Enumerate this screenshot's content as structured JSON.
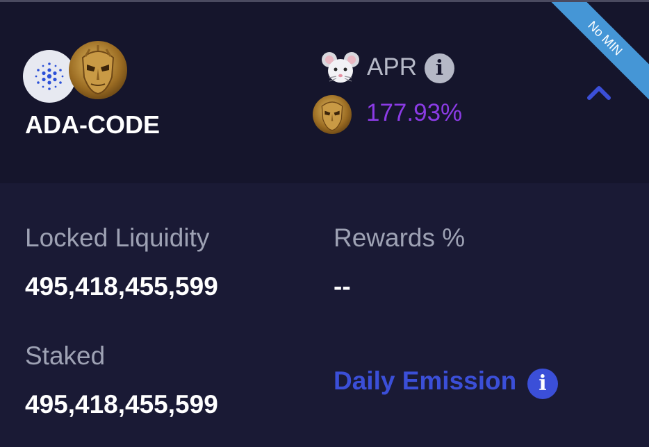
{
  "farm": {
    "pair_name": "ADA-CODE",
    "badge": "No MIN",
    "apr_label": "APR",
    "apr_value": "177.93%",
    "apr_color": "#8b3be5",
    "tokens": [
      "cardano-icon",
      "mask-coin-icon"
    ]
  },
  "details": {
    "locked_liquidity_label": "Locked Liquidity",
    "locked_liquidity_value": "495,418,455,599",
    "rewards_label": "Rewards %",
    "rewards_value": "--",
    "staked_label": "Staked",
    "staked_value": "495,418,455,599",
    "daily_emission_label": "Daily Emission"
  },
  "colors": {
    "header_bg": "#15152c",
    "body_bg": "#1a1a35",
    "accent": "#3b4fd8",
    "ribbon": "#4596d6"
  }
}
